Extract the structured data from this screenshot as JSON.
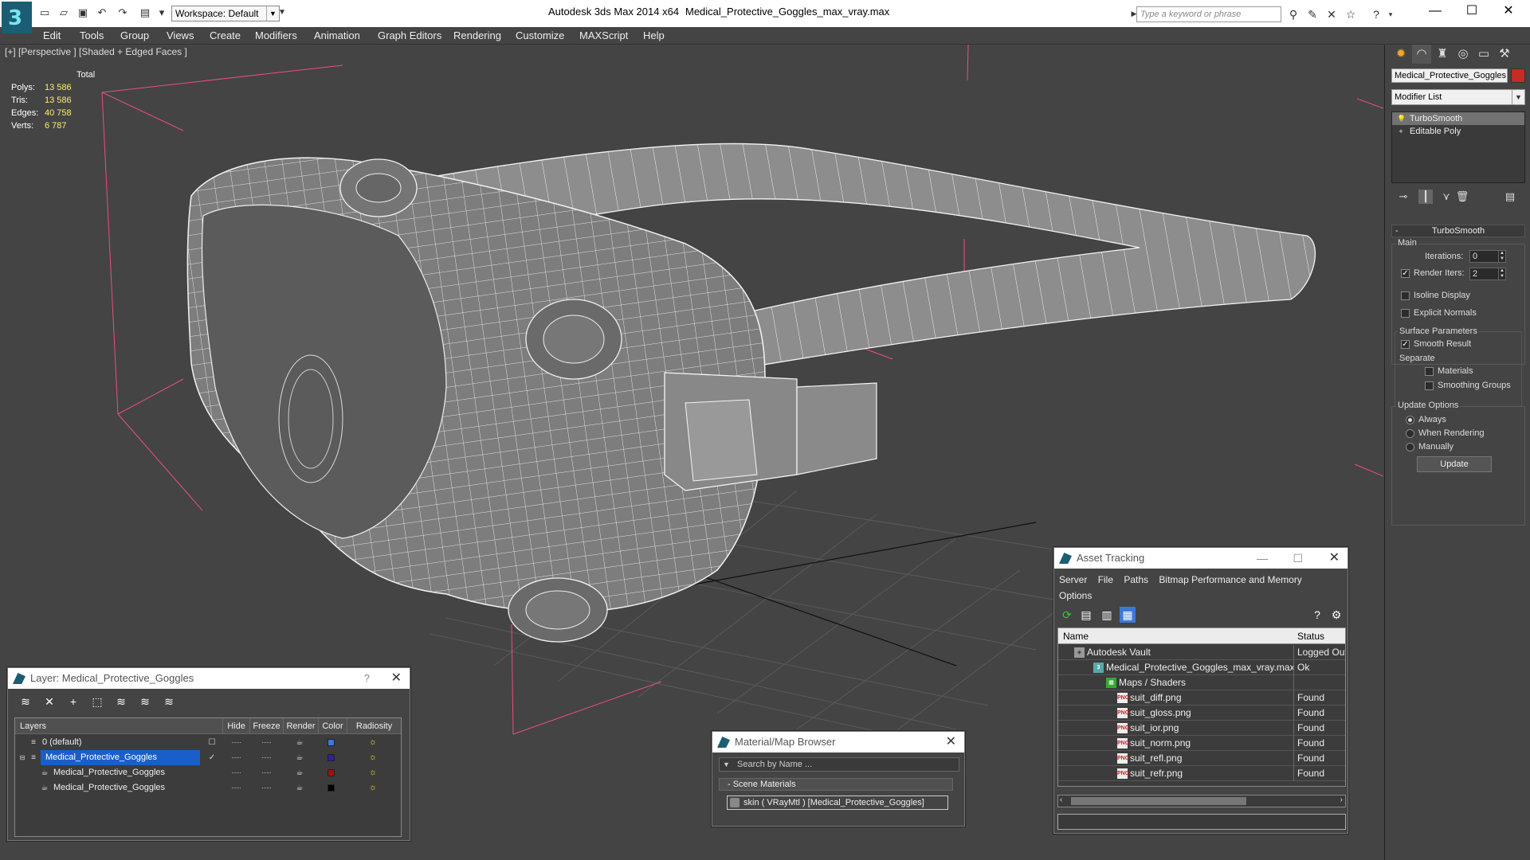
{
  "titlebar": {
    "app": "Autodesk 3ds Max  2014 x64",
    "file": "Medical_Protective_Goggles_max_vray.max",
    "workspace": "Workspace: Default",
    "search_placeholder": "Type a keyword or phrase"
  },
  "menu": [
    "Edit",
    "Tools",
    "Group",
    "Views",
    "Create",
    "Modifiers",
    "Animation",
    "Graph Editors",
    "Rendering",
    "Customize",
    "MAXScript",
    "Help"
  ],
  "viewport": {
    "label": "[+] [Perspective ] [Shaded + Edged Faces ]",
    "stats_header": "Total",
    "stats": [
      {
        "k": "Polys:",
        "v": "13 586"
      },
      {
        "k": "Tris:",
        "v": "13 586"
      },
      {
        "k": "Edges:",
        "v": "40 758"
      },
      {
        "k": "Verts:",
        "v": "6 787"
      }
    ]
  },
  "cmd": {
    "object_name": "Medical_Protective_Goggles",
    "object_color": "#c72b25",
    "modifier_list": "Modifier List",
    "stack": [
      "TurboSmooth",
      "Editable Poly"
    ],
    "rollout": "TurboSmooth",
    "main": "Main",
    "iterations_label": "Iterations:",
    "iterations": "0",
    "render_iters_label": "Render Iters:",
    "render_iters": "2",
    "isoline": "Isoline Display",
    "explicit": "Explicit Normals",
    "surface": "Surface Parameters",
    "smooth_result": "Smooth Result",
    "separate": "Separate",
    "materials": "Materials",
    "smoothing_groups": "Smoothing Groups",
    "update_options": "Update Options",
    "always": "Always",
    "when_rendering": "When Rendering",
    "manually": "Manually",
    "update_btn": "Update"
  },
  "layers": {
    "title": "Layer: Medical_Protective_Goggles",
    "help": "?",
    "columns": [
      "Layers",
      "Hide",
      "Freeze",
      "Render",
      "Color",
      "Radiosity"
    ],
    "rows": [
      {
        "name": "0 (default)",
        "color": "#3a7ad6"
      },
      {
        "name": "Medical_Protective_Goggles",
        "color": "#2d1fa0"
      },
      {
        "name": "Medical_Protective_Goggles",
        "color": "#a01010"
      },
      {
        "name": "Medical_Protective_Goggles",
        "color": "#000000"
      }
    ]
  },
  "material": {
    "title": "Material/Map Browser",
    "search": "Search by Name ...",
    "section": "- Scene Materials",
    "item": "skin  ( VRayMtl ) [Medical_Protective_Goggles]"
  },
  "asset": {
    "title": "Asset Tracking",
    "menu": [
      "Server",
      "File",
      "Paths",
      "Bitmap Performance and Memory"
    ],
    "menu2": "Options",
    "col_name": "Name",
    "col_status": "Status",
    "rows": [
      {
        "name": "Autodesk Vault",
        "status": "Logged Out",
        "indent": 20
      },
      {
        "name": "Medical_Protective_Goggles_max_vray.max",
        "status": "Ok",
        "indent": 44
      },
      {
        "name": "Maps / Shaders",
        "status": "",
        "indent": 60
      },
      {
        "name": "suit_diff.png",
        "status": "Found",
        "indent": 74
      },
      {
        "name": "suit_gloss.png",
        "status": "Found",
        "indent": 74
      },
      {
        "name": "suit_ior.png",
        "status": "Found",
        "indent": 74
      },
      {
        "name": "suit_norm.png",
        "status": "Found",
        "indent": 74
      },
      {
        "name": "suit_refl.png",
        "status": "Found",
        "indent": 74
      },
      {
        "name": "suit_refr.png",
        "status": "Found",
        "indent": 74
      }
    ]
  }
}
